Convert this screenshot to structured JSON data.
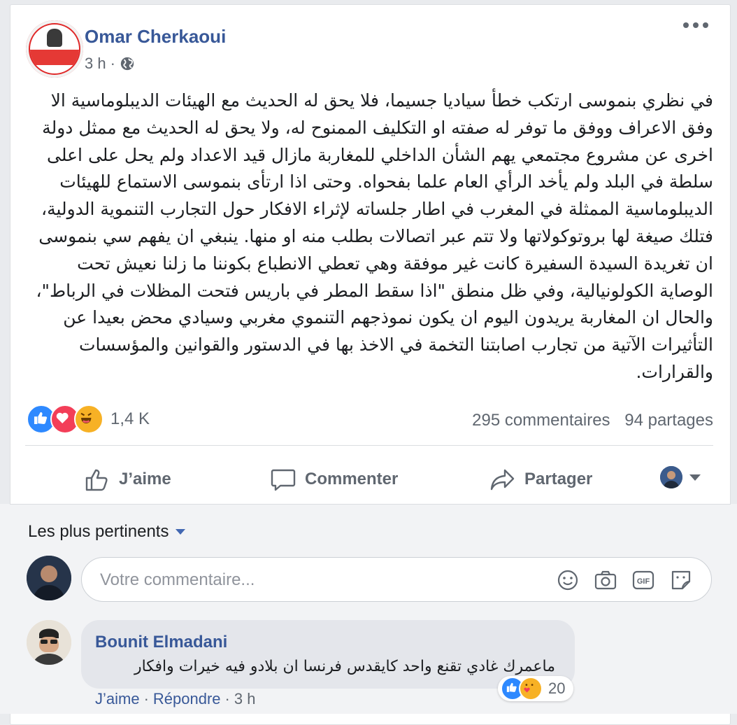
{
  "post": {
    "author": "Omar Cherkaoui",
    "time": "3 h",
    "dot": "·",
    "text": "في نظري بنموسى ارتكب خطأ سياديا جسيما، فلا يحق له الحديث مع الهيئات الديبلوماسية الا وفق الاعراف ووفق ما توفر له صفته او التكليف الممنوح له، ولا يحق له الحديث مع ممثل دولة اخرى عن مشروع مجتمعي يهم الشأن الداخلي للمغاربة مازال قيد الاعداد ولم يحل على اعلى سلطة في البلد ولم يأخد الرأي العام علما بفحواه. وحتى اذا ارتأى بنموسى الاستماع للهيئات الديبلوماسية الممثلة في المغرب في اطار جلساته لإثراء الافكار حول التجارب التنموية الدولية، فتلك صيغة لها بروتوكولاتها ولا تتم عبر اتصالات بطلب منه او منها. ينبغي ان يفهم سي بنموسى ان تغريدة السيدة السفيرة كانت غير موفقة وهي تعطي الانطباع بكوننا ما زلنا نعيش تحت الوصاية الكولونيالية، وفي ظل منطق \"اذا سقط المطر في باريس فتحت المظلات في الرباط\"، والحال ان المغاربة يريدون اليوم ان يكون نموذجهم التنموي مغربي وسيادي محض بعيدا عن التأثيرات الآتية من تجارب اصابتنا التخمة في الاخذ بها في الدستور والقوانين والمؤسسات والقرارات."
  },
  "reactions": {
    "count": "1,4 K",
    "types": [
      "like",
      "love",
      "haha"
    ]
  },
  "stats": {
    "comments": "295 commentaires",
    "shares": "94 partages"
  },
  "actions": {
    "like": "J’aime",
    "comment": "Commenter",
    "share": "Partager"
  },
  "comments": {
    "sort_label": "Les plus pertinents",
    "input_placeholder": "Votre commentaire...",
    "input_icons": [
      "emoji-icon",
      "camera-icon",
      "gif-icon",
      "sticker-icon"
    ],
    "items": [
      {
        "author": "Bounit Elmadani",
        "text": "ماعمرك غادي تقنع واحد كايقدس فرنسا ان بلادو فيه خيرات وافكار",
        "reaction_count": "20",
        "like": "J’aime",
        "reply": "Répondre",
        "time": "3 h",
        "sep": "·"
      }
    ]
  },
  "colors": {
    "link": "#385898",
    "meta": "#606770",
    "like": "#2e89ff",
    "love": "#f33e58",
    "haha": "#f7b125"
  }
}
